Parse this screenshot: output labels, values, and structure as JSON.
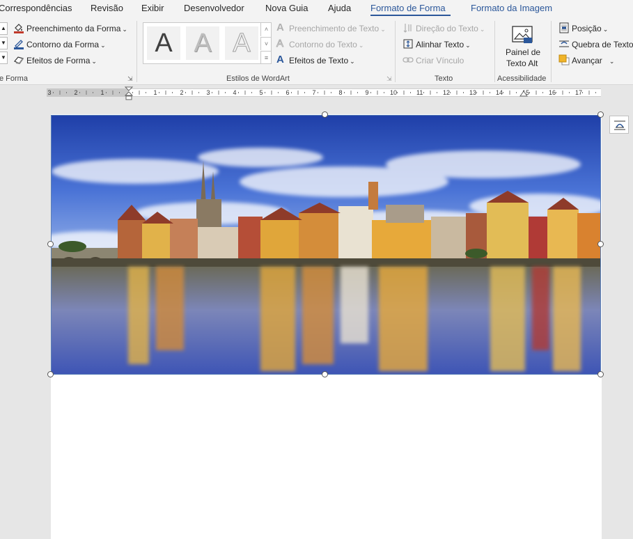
{
  "tabs": {
    "items": [
      {
        "label": "Correspondências"
      },
      {
        "label": "Revisão"
      },
      {
        "label": "Exibir"
      },
      {
        "label": "Desenvolvedor"
      },
      {
        "label": "Nova Guia"
      },
      {
        "label": "Ajuda"
      },
      {
        "label": "Formato de Forma"
      },
      {
        "label": "Formato da Imagem"
      }
    ],
    "active": "Formato de Forma"
  },
  "ribbon": {
    "shape_styles": {
      "fill": "Preenchimento da Forma",
      "outline": "Contorno da Forma",
      "effects": "Efeitos de Forma",
      "group_label": "e Forma"
    },
    "wordart": {
      "text_fill": "Preenchimento de Texto",
      "text_outline": "Contorno do Texto",
      "text_effects": "Efeitos de Texto",
      "group_label": "Estilos de WordArt",
      "sample_letter": "A"
    },
    "text": {
      "direction": "Direção do Texto",
      "align": "Alinhar Texto",
      "link": "Criar Vínculo",
      "group_label": "Texto"
    },
    "accessibility": {
      "alt_text_line1": "Painel de",
      "alt_text_line2": "Texto Alt",
      "group_label": "Acessibilidade"
    },
    "arrange": {
      "position": "Posição",
      "wrap": "Quebra de Texto",
      "forward": "Avançar"
    }
  },
  "ruler": {
    "numbers": [
      "3",
      "2",
      "1",
      "1",
      "2",
      "3",
      "4",
      "5",
      "6",
      "7",
      "8",
      "9",
      "10",
      "11",
      "12",
      "13",
      "14",
      "15",
      "16",
      "17"
    ]
  },
  "colors": {
    "accent": "#2b579a",
    "ribbon_bg": "#f3f3f3",
    "canvas_bg": "#e6e6e6"
  }
}
